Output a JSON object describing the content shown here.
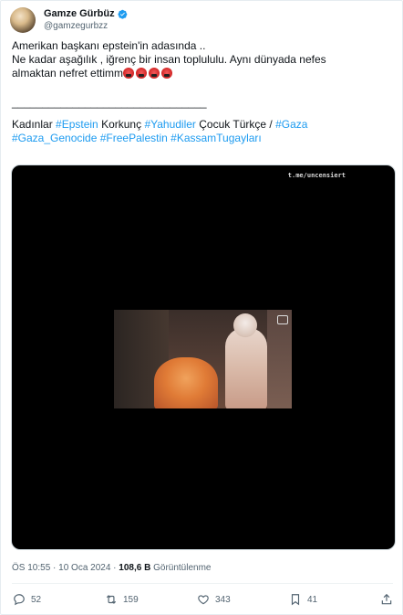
{
  "author": {
    "display_name": "Gamze Gürbüz",
    "handle": "@gamzegurbzz"
  },
  "tweet": {
    "line1": "Amerikan başkanı epstein'in adasında ..",
    "line2": "Ne kadar aşağılık , iğrenç bir insan toplululu. Aynı dünyada nefes",
    "line3": "almaktan nefret ettimm",
    "separator": "________________________________",
    "tags_line1": {
      "word1": "Kadınlar ",
      "tag1": "#Epstein",
      "word2": " Korkunç ",
      "tag2": "#Yahudiler",
      "word3": "  Çocuk Türkçe / ",
      "tag3": "#Gaza"
    },
    "tags_line2": {
      "tag1": "#Gaza_Genocide",
      "tag2": "#FreePalestin",
      "tag3": "#KassamTugayları"
    }
  },
  "media": {
    "watermark": "t.me/uncensiert"
  },
  "meta": {
    "timestamp": "ÖS 10:55 · 10 Oca 2024 · ",
    "views_count": "108,6 B",
    "views_label": " Görüntülenme"
  },
  "actions": {
    "replies": "52",
    "reposts": "159",
    "likes": "343",
    "bookmarks": "41"
  },
  "colors": {
    "accent": "#1d9bf0",
    "text": "#0f1419",
    "secondary": "#536471"
  }
}
